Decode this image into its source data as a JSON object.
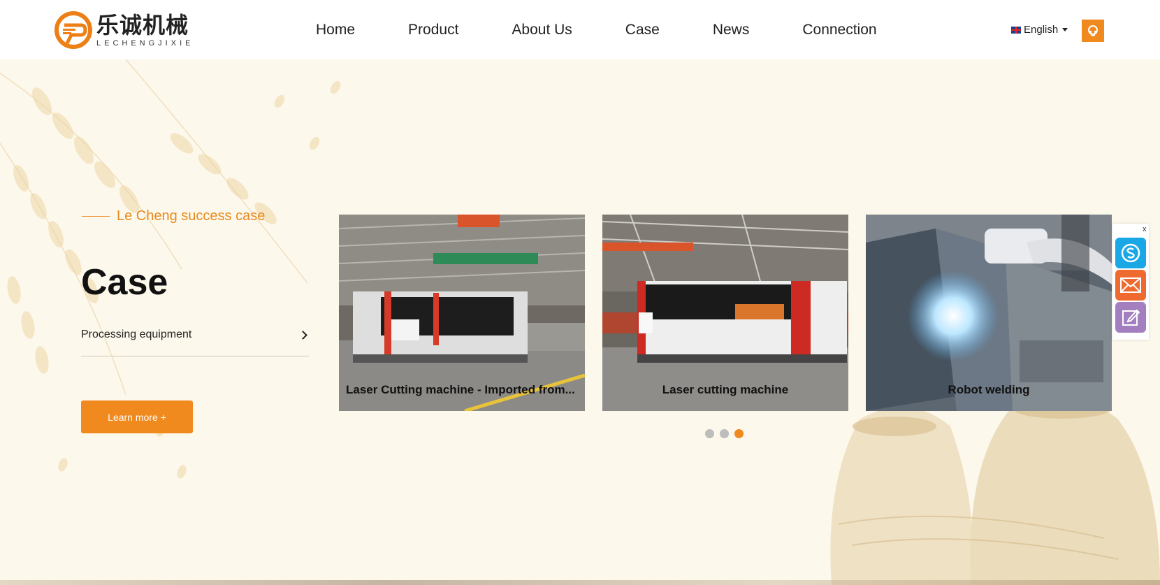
{
  "header": {
    "logo": {
      "chinese": "乐诚机械",
      "english": "LECHENGJIXIE"
    },
    "nav": [
      "Home",
      "Product",
      "About Us",
      "Case",
      "News",
      "Connection"
    ],
    "language": "English"
  },
  "hero": {
    "subtitle": "Le Cheng success case",
    "title": "Case",
    "category": "Processing equipment",
    "learn_more": "Learn more +"
  },
  "cards": [
    {
      "caption": "Laser Cutting machine - Imported from..."
    },
    {
      "caption": "Laser cutting machine"
    },
    {
      "caption": "Robot welding"
    }
  ],
  "carousel": {
    "total": 3,
    "active": 3
  },
  "side_bar": {
    "close": "x",
    "icons": [
      "skype-icon",
      "mail-icon",
      "edit-icon"
    ]
  },
  "colors": {
    "accent": "#f08a1e",
    "background": "#fdf8ec",
    "skype": "#1aa7e6",
    "mail": "#ef6a2f",
    "edit": "#a47fc0"
  }
}
